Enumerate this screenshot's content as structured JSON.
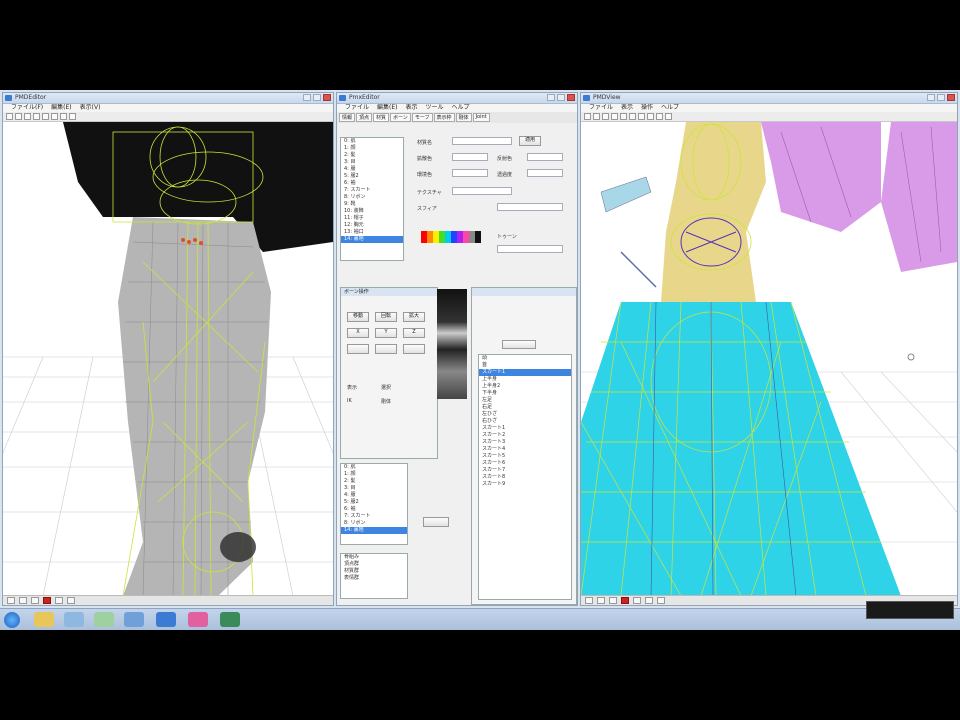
{
  "left_window": {
    "title": "PMDEditor",
    "menu": [
      "ファイル(F)",
      "編集(E)",
      "表示(V)"
    ]
  },
  "center_window": {
    "title": "PmxEditor",
    "menu": [
      "ファイル",
      "編集(E)",
      "表示",
      "ツール",
      "ヘルプ"
    ],
    "tabs": [
      "情報",
      "頂点",
      "材質",
      "ボーン",
      "モーフ",
      "表示枠",
      "剛体",
      "Joint"
    ],
    "materials_list": [
      "0: 肌",
      "1: 顔",
      "2: 髪",
      "3: 目",
      "4: 服",
      "5: 服2",
      "6: 袖",
      "7: スカート",
      "8: リボン",
      "9: 靴",
      "10: 装飾",
      "11: 帽子",
      "12: 胸元",
      "13: 袖口",
      "14: 裏地"
    ],
    "selected_material": "14: 裏地",
    "properties_labels": [
      "材質名",
      "拡散色",
      "反射色",
      "環境色",
      "透過度",
      "テクスチャ",
      "スフィア",
      "トゥーン"
    ],
    "sub_panel_title": "ボーン操作",
    "sub_panel_buttons": [
      "移動",
      "回転",
      "拡大",
      "X",
      "Y",
      "Z"
    ],
    "bones_list": [
      "頭",
      "首",
      "上半身",
      "上半身2",
      "下半身",
      "左足",
      "右足",
      "左ひざ",
      "右ひざ",
      "スカート1",
      "スカート2",
      "スカート3",
      "スカート4",
      "スカート5",
      "スカート6",
      "スカート7",
      "スカート8",
      "スカート9"
    ],
    "selected_bone": "スカート1",
    "checkbox_labels": [
      "表示",
      "選択",
      "IK",
      "剛体"
    ],
    "bottom_list": [
      "骨組み",
      "頂点群",
      "材質群",
      "表情群"
    ],
    "apply_label": "適用"
  },
  "right_window": {
    "title": "PMDView",
    "menu": [
      "ファイル",
      "表示",
      "操作",
      "ヘルプ"
    ]
  },
  "accent": "#3d85e0",
  "wire_color": "#c8e63a",
  "skirt_color": "#2fd3e8",
  "cloth_color": "#d99be8"
}
